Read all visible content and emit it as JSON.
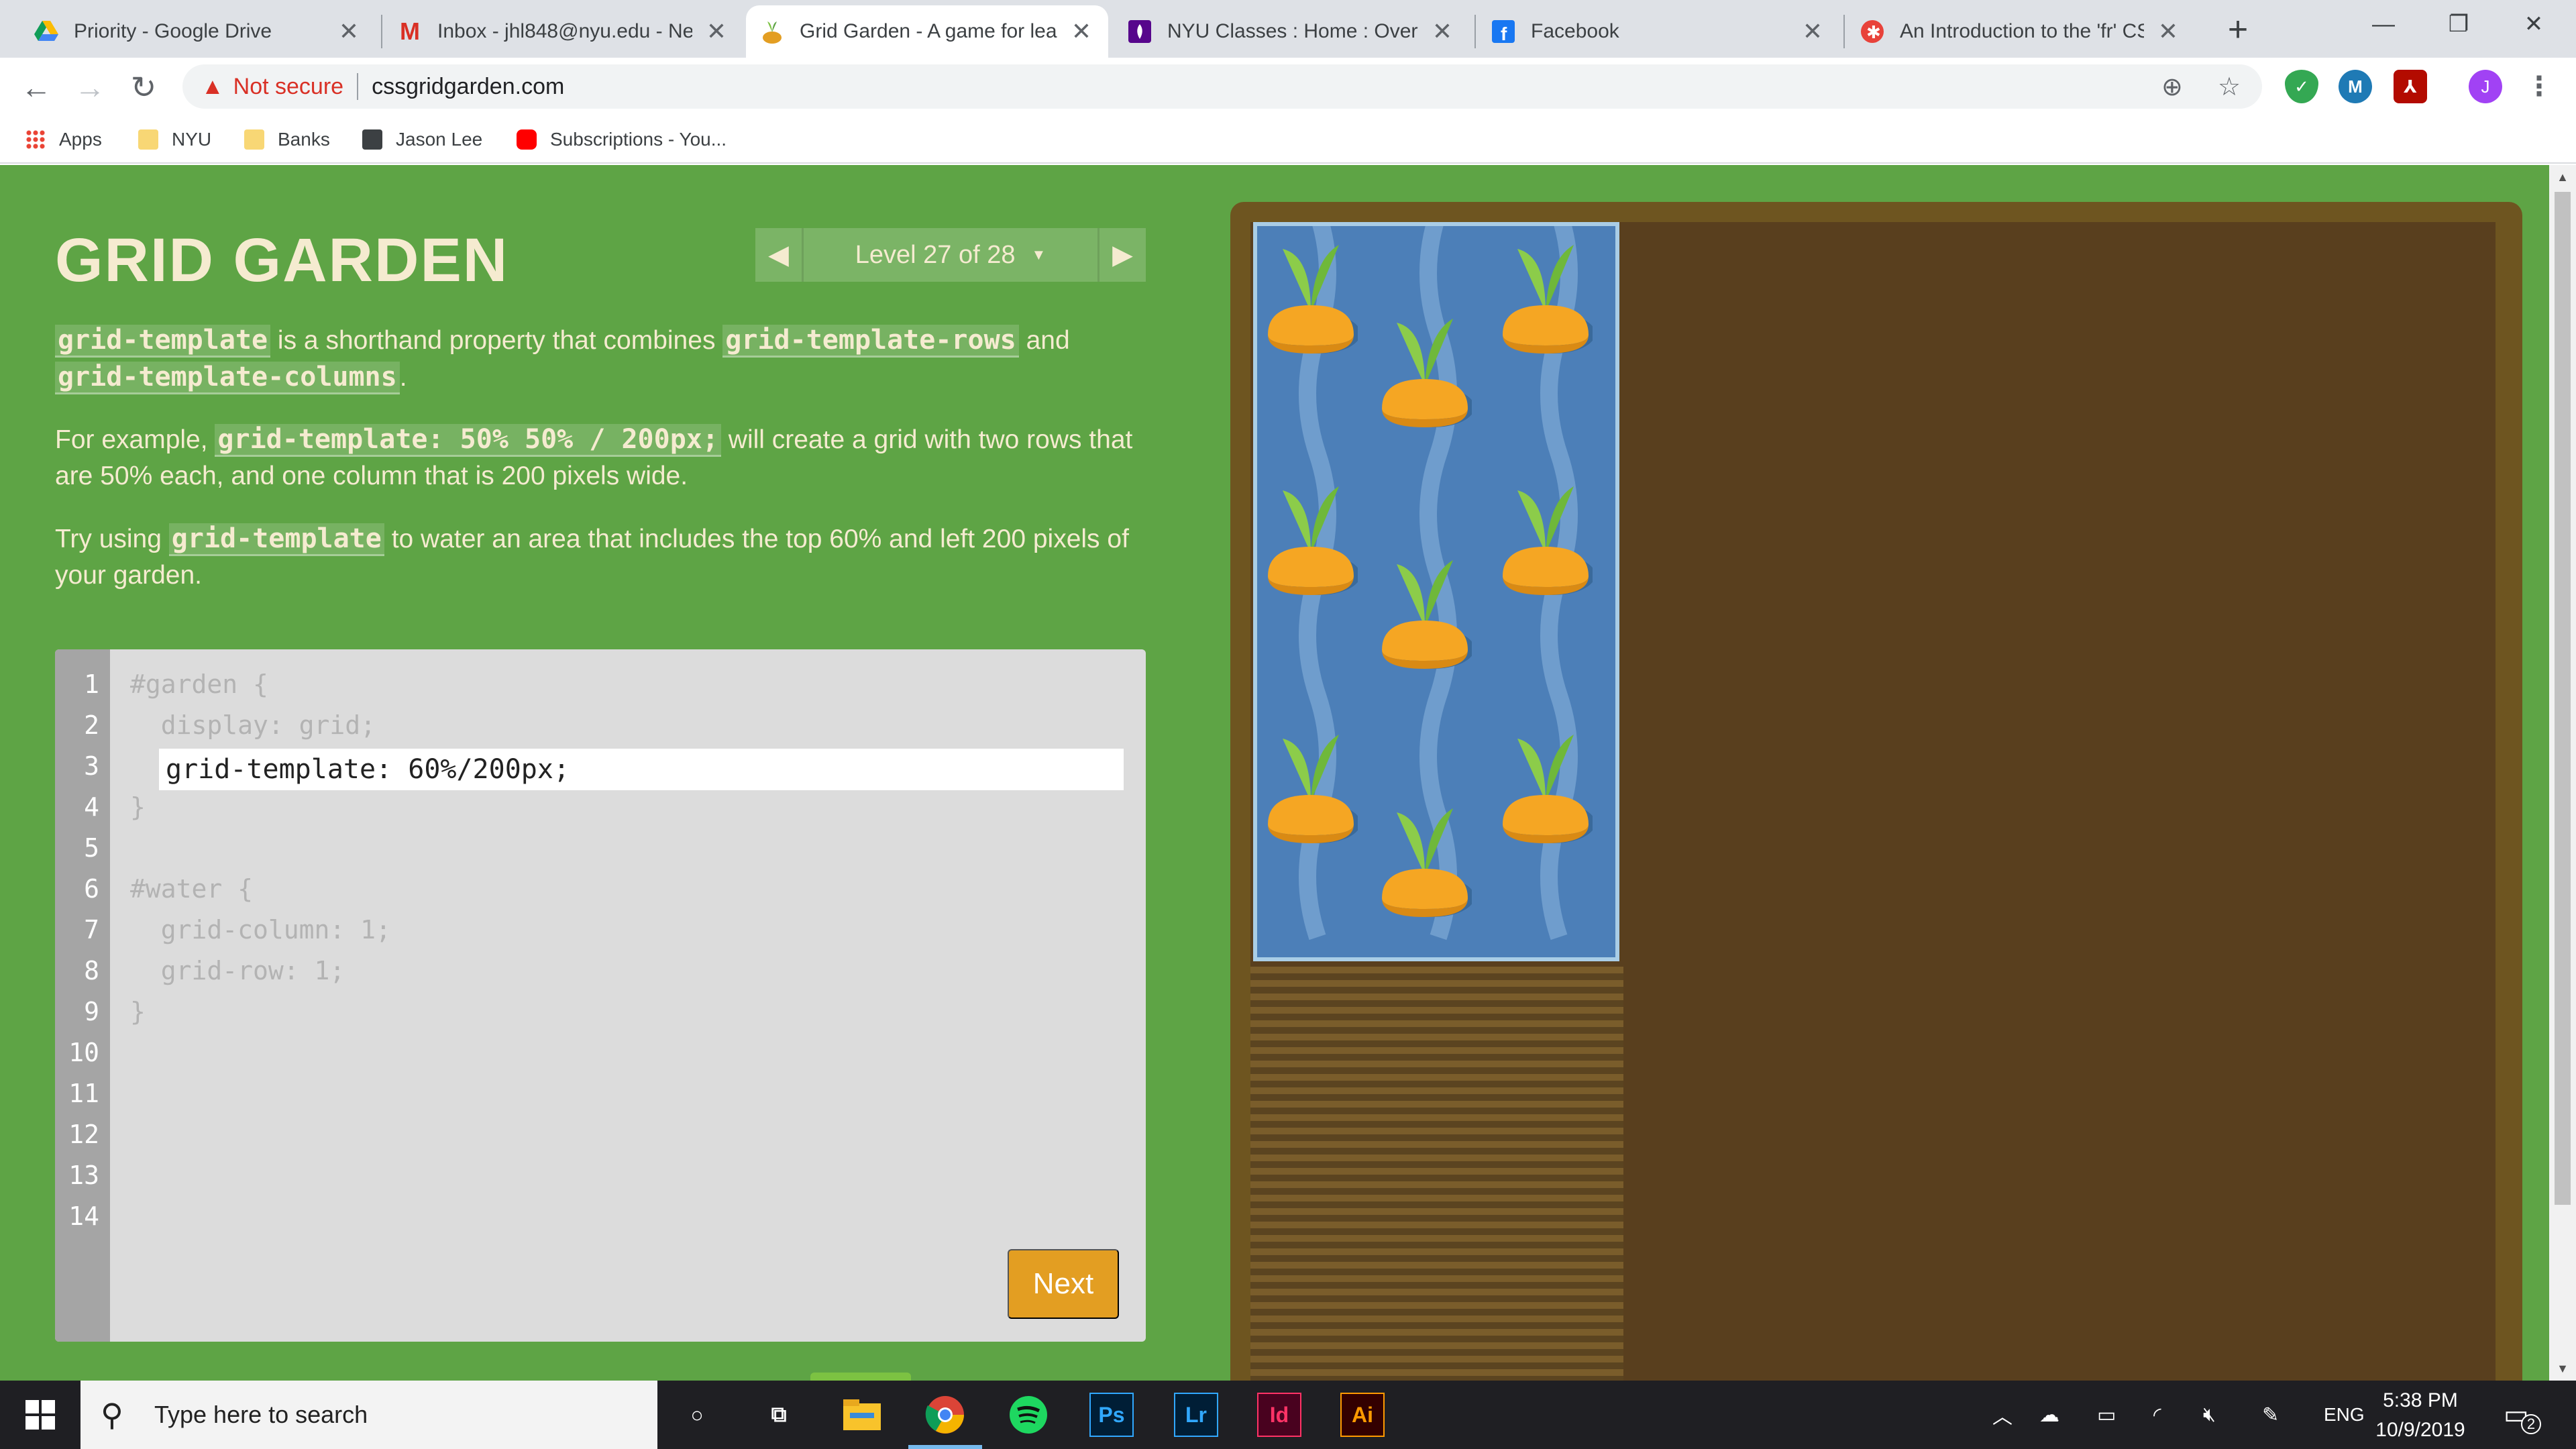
{
  "browser": {
    "tabs": [
      {
        "title": "Priority - Google Drive",
        "favicon": "google-drive-icon"
      },
      {
        "title": "Inbox - jhl848@nyu.edu - Ne",
        "favicon": "gmail-icon"
      },
      {
        "title": "Grid Garden - A game for lea",
        "favicon": "grid-garden-icon",
        "active": true
      },
      {
        "title": "NYU Classes : Home : Overvi",
        "favicon": "nyu-icon"
      },
      {
        "title": "Facebook",
        "favicon": "facebook-icon"
      },
      {
        "title": "An Introduction to the 'fr' CS",
        "favicon": "css-tricks-icon"
      }
    ],
    "security_label": "Not secure",
    "url": "cssgridgarden.com",
    "bookmarks": [
      {
        "label": "Apps",
        "icon": "apps-grid-icon"
      },
      {
        "label": "NYU",
        "icon": "folder-icon"
      },
      {
        "label": "Banks",
        "icon": "folder-icon"
      },
      {
        "label": "Jason Lee",
        "icon": "cube-icon"
      },
      {
        "label": "Subscriptions - You...",
        "icon": "youtube-icon"
      }
    ],
    "profile_initial": "J"
  },
  "game": {
    "logo": "GRID GARDEN",
    "level_label": "Level 27 of 28",
    "instructions": {
      "p1": {
        "code1": "grid-template",
        "text1": " is a shorthand property that combines ",
        "code2": "grid-template-rows",
        "text2": " and ",
        "code3": "grid-template-columns",
        "text3": "."
      },
      "p2": {
        "text1": "For example, ",
        "code1": "grid-template: 50% 50% / 200px;",
        "text2": " will create a grid with two rows that are 50% each, and one column that is 200 pixels wide."
      },
      "p3": {
        "text1": "Try using ",
        "code1": "grid-template",
        "text2": " to water an area that includes the top 60% and left 200 pixels of your garden."
      }
    },
    "editor": {
      "line_numbers": [
        "1",
        "2",
        "3",
        "4",
        "5",
        "6",
        "7",
        "8",
        "9",
        "10",
        "11",
        "12",
        "13",
        "14"
      ],
      "lines": {
        "l1": "#garden {",
        "l2": "  display: grid;",
        "l4": "}",
        "l6": "#water {",
        "l7": "  grid-column: 1;",
        "l8": "  grid-row: 1;",
        "l9": "}"
      },
      "input_value": "grid-template: 60%/200px;",
      "next_label": "Next"
    },
    "colors": {
      "background": "#5ea445",
      "text": "#f5ebd0",
      "water": "#4c7fb8",
      "soil": "#593f1e",
      "next_button": "#e39e22"
    }
  },
  "taskbar": {
    "search_placeholder": "Type here to search",
    "language": "ENG",
    "time": "5:38 PM",
    "date": "10/9/2019",
    "notification_count": "2",
    "apps": [
      {
        "name": "cortana-icon"
      },
      {
        "name": "task-view-icon"
      },
      {
        "name": "file-explorer-icon"
      },
      {
        "name": "chrome-icon"
      },
      {
        "name": "spotify-icon"
      },
      {
        "label": "Ps",
        "name": "photoshop-icon"
      },
      {
        "label": "Lr",
        "name": "lightroom-icon"
      },
      {
        "label": "Id",
        "name": "indesign-icon"
      },
      {
        "label": "Ai",
        "name": "illustrator-icon"
      }
    ]
  }
}
